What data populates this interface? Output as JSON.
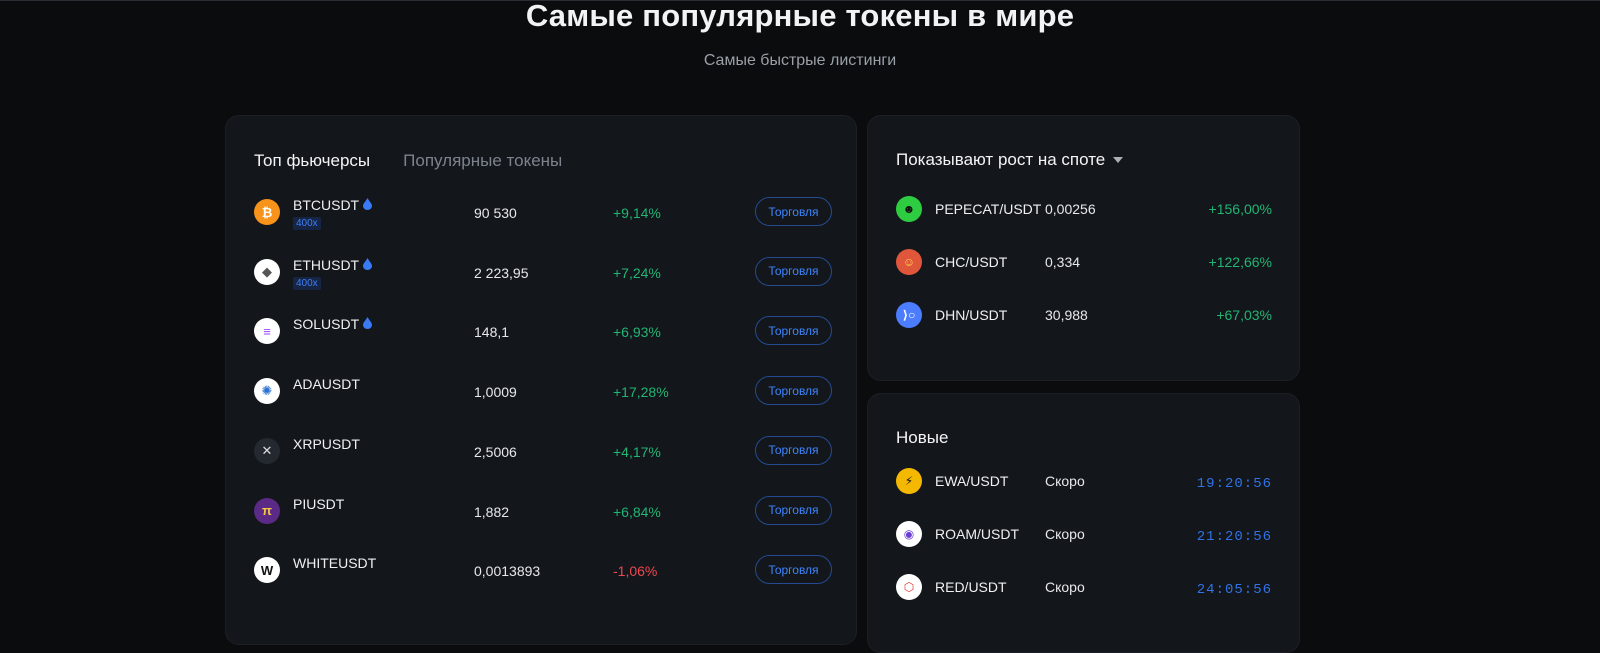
{
  "hero": {
    "title": "Самые популярные токены в мире",
    "subtitle": "Самые быстрые листинги"
  },
  "futures": {
    "tabs": [
      "Топ фьючерсы",
      "Популярные токены"
    ],
    "trade_label": "Торговля",
    "rows": [
      {
        "pair": "BTCUSDT",
        "hot": true,
        "leverage": "400x",
        "price": "90 530",
        "change": "+9,14%",
        "direction": "up",
        "icon": "bitcoin-icon",
        "color": "#f7931a"
      },
      {
        "pair": "ETHUSDT",
        "hot": true,
        "leverage": "400x",
        "price": "2 223,95",
        "change": "+7,24%",
        "direction": "up",
        "icon": "ethereum-icon",
        "color": "#ffffff"
      },
      {
        "pair": "SOLUSDT",
        "hot": true,
        "leverage": "",
        "price": "148,1",
        "change": "+6,93%",
        "direction": "up",
        "icon": "solana-icon",
        "color": "#ffffff"
      },
      {
        "pair": "ADAUSDT",
        "hot": false,
        "leverage": "",
        "price": "1,0009",
        "change": "+17,28%",
        "direction": "up",
        "icon": "cardano-icon",
        "color": "#ffffff"
      },
      {
        "pair": "XRPUSDT",
        "hot": false,
        "leverage": "",
        "price": "2,5006",
        "change": "+4,17%",
        "direction": "up",
        "icon": "xrp-icon",
        "color": "#23292f"
      },
      {
        "pair": "PIUSDT",
        "hot": false,
        "leverage": "",
        "price": "1,882",
        "change": "+6,84%",
        "direction": "up",
        "icon": "pi-icon",
        "color": "#5b2a86"
      },
      {
        "pair": "WHITEUSDT",
        "hot": false,
        "leverage": "",
        "price": "0,0013893",
        "change": "-1,06%",
        "direction": "down",
        "icon": "white-icon",
        "color": "#ffffff"
      }
    ]
  },
  "spot": {
    "title": "Показывают рост на споте",
    "rows": [
      {
        "pair": "PEPECAT/USDT",
        "price": "0,00256",
        "change": "+156,00%",
        "icon": "pepecat-icon",
        "color": "#2ecc40"
      },
      {
        "pair": "CHC/USDT",
        "price": "0,334",
        "change": "+122,66%",
        "icon": "chc-icon",
        "color": "#e0563b"
      },
      {
        "pair": "DHN/USDT",
        "price": "30,988",
        "change": "+67,03%",
        "icon": "dhn-icon",
        "color": "#4c7dff"
      }
    ]
  },
  "new_listings": {
    "title": "Новые",
    "rows": [
      {
        "pair": "EWA/USDT",
        "status": "Скоро",
        "countdown": "19:20:56",
        "icon": "ewa-icon",
        "color": "#f5b800"
      },
      {
        "pair": "ROAM/USDT",
        "status": "Скоро",
        "countdown": "21:20:56",
        "icon": "roam-icon",
        "color": "#ffffff"
      },
      {
        "pair": "RED/USDT",
        "status": "Скоро",
        "countdown": "24:05:56",
        "icon": "red-icon",
        "color": "#ffffff"
      }
    ]
  }
}
